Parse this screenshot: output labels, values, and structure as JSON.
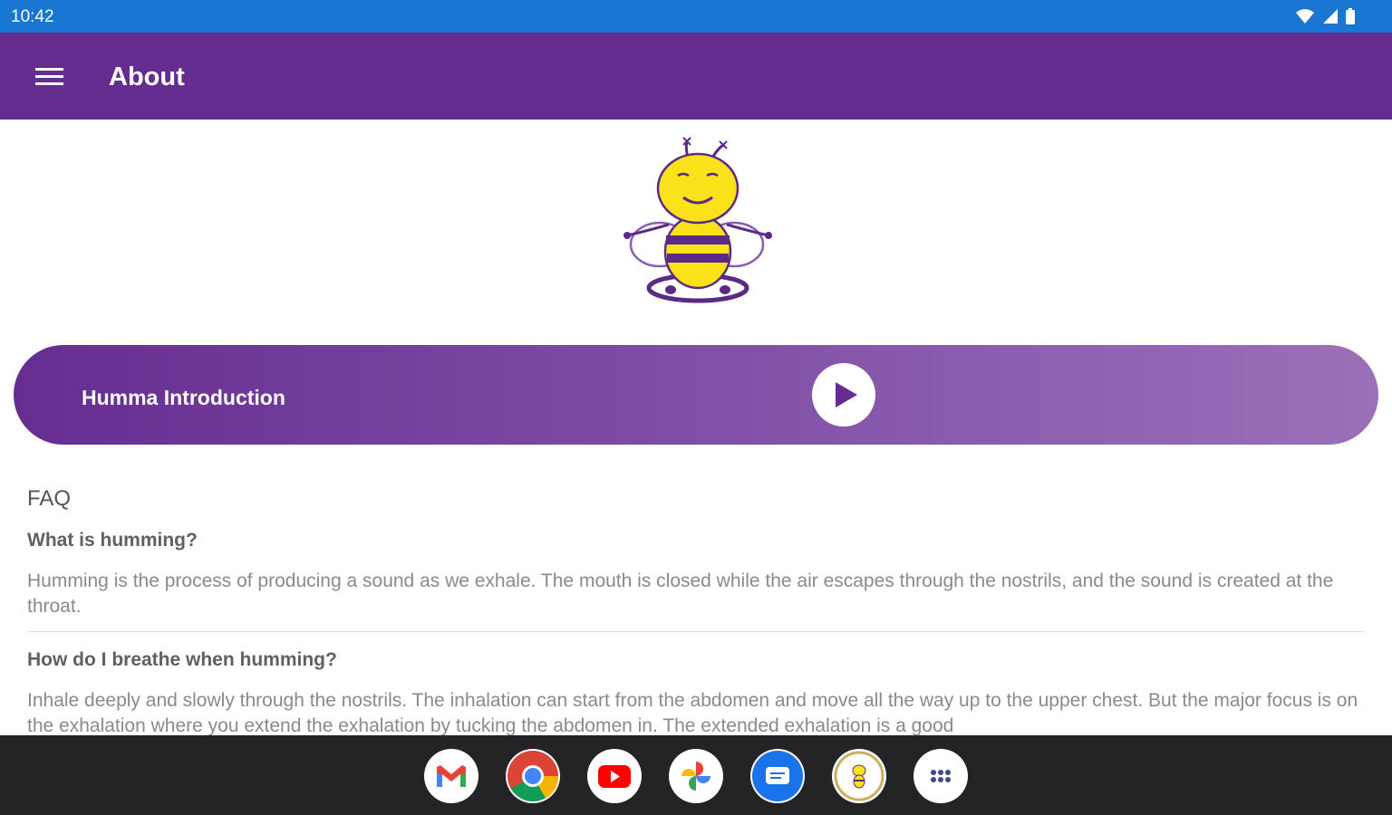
{
  "status_bar": {
    "time": "10:42"
  },
  "app_bar": {
    "title": "About",
    "menu_icon": "hamburger-menu-icon"
  },
  "intro": {
    "label": "Humma Introduction",
    "play_icon": "play-icon"
  },
  "faq": {
    "heading": "FAQ",
    "items": [
      {
        "question": "What is humming?",
        "answer": "Humming is the process of producing a sound as we exhale. The mouth is closed while the air escapes through the nostrils, and the sound is created at the throat."
      },
      {
        "question": "How do I breathe when humming?",
        "answer": "Inhale deeply and slowly through the nostrils. The inhalation can start from the abdomen and move all the way up to the upper chest. But the major focus is on the exhalation where you extend the exhalation by tucking the abdomen in. The extended exhalation is a good"
      }
    ]
  },
  "dock": {
    "apps": [
      "gmail-icon",
      "chrome-icon",
      "youtube-icon",
      "google-photos-icon",
      "messages-icon",
      "humma-app-icon",
      "app-drawer-icon"
    ]
  },
  "colors": {
    "status_bar": "#1976d2",
    "app_bar": "#662d91",
    "accent": "#662d91",
    "dock": "#242427"
  }
}
